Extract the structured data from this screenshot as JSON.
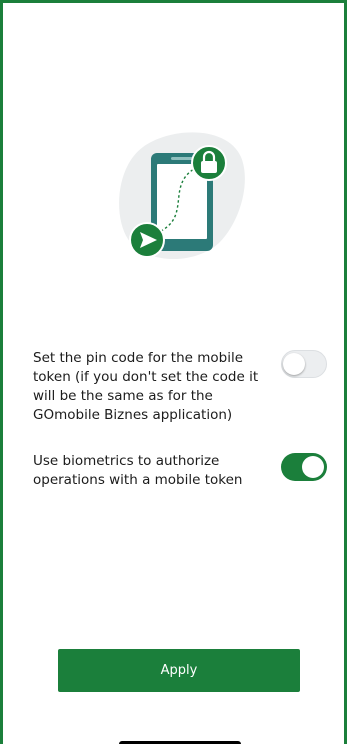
{
  "illustration": {
    "icon": "phone-lock-send-icon",
    "blob_color": "#eceeef",
    "phone_color": "#2c7a78",
    "accent_color": "#1b7f3b"
  },
  "settings": {
    "pin_code": {
      "label": "Set the pin code for the mobile token (if you don't set the code it will be the same as for the GOmobile Biznes application)",
      "enabled": false
    },
    "biometrics": {
      "label": "Use biometrics to authorize operations with a mobile token",
      "enabled": true
    }
  },
  "actions": {
    "apply_label": "Apply"
  },
  "colors": {
    "brand_green": "#1b7f3b",
    "border_green": "#1b7f3b"
  }
}
